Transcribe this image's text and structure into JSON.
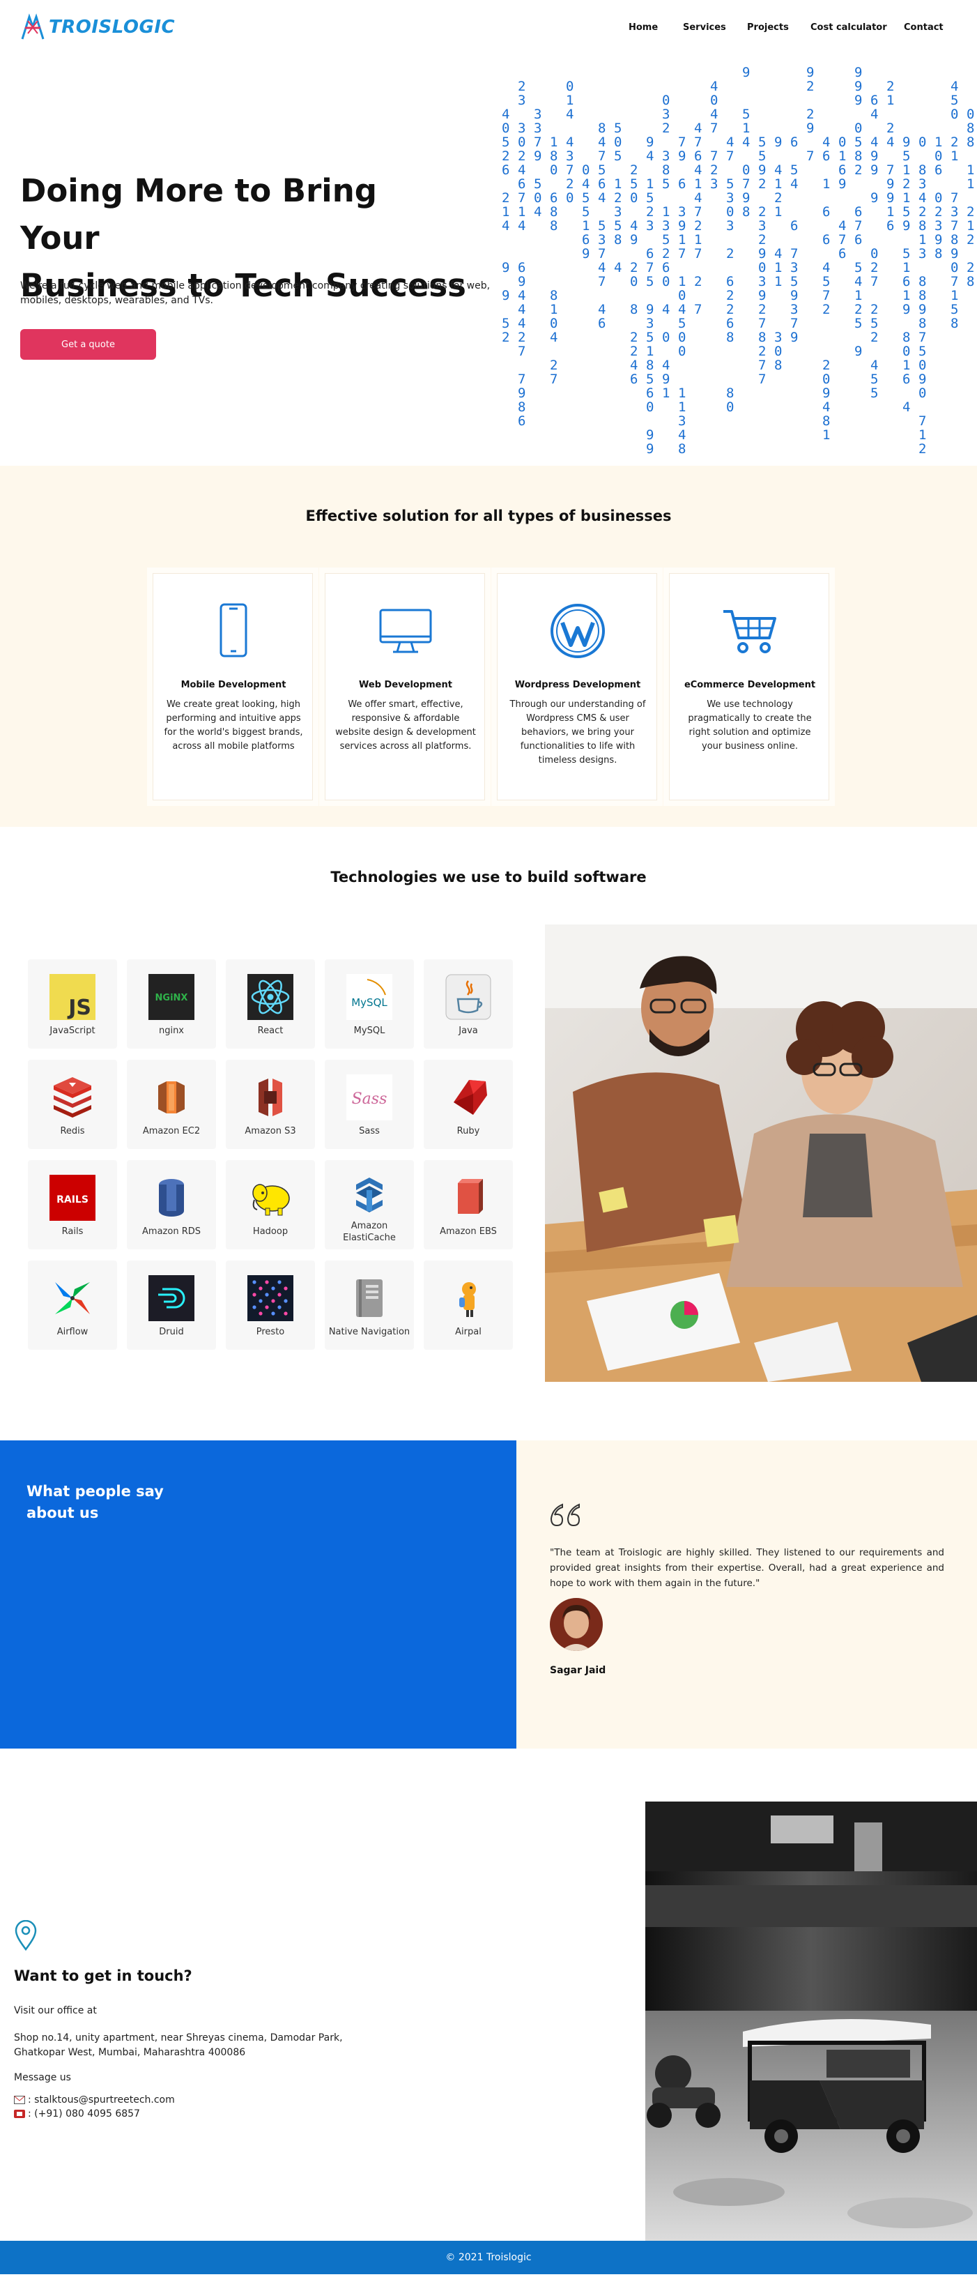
{
  "brand": {
    "name": "TROISLOGIC"
  },
  "nav": {
    "items": [
      "Home",
      "Services",
      "Projects",
      "Cost calculator",
      "Contact"
    ]
  },
  "hero": {
    "title_line1": "Doing More to Bring Your",
    "title_line2": "Business to Tech Success",
    "subtitle": "We're a full-cycle web and mobile application development company creating solutions for web, mobiles, desktops, wearables, and TVs.",
    "cta": "Get a quote"
  },
  "solutions": {
    "title": "Effective solution for all types of businesses",
    "cards": [
      {
        "icon": "mobile-icon",
        "title": "Mobile Development",
        "desc": "We create great looking, high performing and intuitive apps for the world's biggest brands, across all mobile platforms"
      },
      {
        "icon": "monitor-icon",
        "title": "Web Development",
        "desc": "We offer smart, effective, responsive & affordable website design & development services across all platforms."
      },
      {
        "icon": "wordpress-icon",
        "title": "Wordpress Development",
        "desc": "Through our understanding of Wordpress CMS & user behaviors, we bring your functionalities to life with timeless designs."
      },
      {
        "icon": "cart-icon",
        "title": "eCommerce Development",
        "desc": "We use technology pragmatically to create the right solution and optimize your business online."
      }
    ]
  },
  "tech": {
    "title": "Technologies we use to build software",
    "items": [
      {
        "name": "JavaScript",
        "icon": "javascript-logo"
      },
      {
        "name": "nginx",
        "icon": "nginx-logo"
      },
      {
        "name": "React",
        "icon": "react-logo"
      },
      {
        "name": "MySQL",
        "icon": "mysql-logo"
      },
      {
        "name": "Java",
        "icon": "java-logo"
      },
      {
        "name": "Redis",
        "icon": "redis-logo"
      },
      {
        "name": "Amazon EC2",
        "icon": "ec2-logo"
      },
      {
        "name": "Amazon S3",
        "icon": "s3-logo"
      },
      {
        "name": "Sass",
        "icon": "sass-logo"
      },
      {
        "name": "Ruby",
        "icon": "ruby-logo"
      },
      {
        "name": "Rails",
        "icon": "rails-logo"
      },
      {
        "name": "Amazon RDS",
        "icon": "rds-logo"
      },
      {
        "name": "Hadoop",
        "icon": "hadoop-logo"
      },
      {
        "name": "Amazon ElastiCache",
        "icon": "elasticache-logo"
      },
      {
        "name": "Amazon EBS",
        "icon": "ebs-logo"
      },
      {
        "name": "Airflow",
        "icon": "airflow-logo"
      },
      {
        "name": "Druid",
        "icon": "druid-logo"
      },
      {
        "name": "Presto",
        "icon": "presto-logo"
      },
      {
        "name": "Native Navigation",
        "icon": "native-navigation-logo"
      },
      {
        "name": "Airpal",
        "icon": "airpal-logo"
      }
    ],
    "logo_js_text": "JS",
    "logo_nginx_text": "NGiNX",
    "logo_mysql_text": "MySQL",
    "logo_sass_text": "Sass",
    "logo_rails_text": "RAILS"
  },
  "testimonial": {
    "heading_line1": "What people say",
    "heading_line2": "about us",
    "quote": "\"The team at Troislogic are highly skilled. They listened to our requirements and provided great insights from their expertise. Overall, had a great experience and hope to work with them again in the future.\"",
    "author": "Sagar Jaid"
  },
  "contact": {
    "title": "Want to get in touch?",
    "visit_label": "Visit our office at",
    "address_line1": "Shop no.14, unity apartment, near Shreyas cinema, Damodar Park,",
    "address_line2": "Ghatkopar West, Mumbai, Maharashtra 400086",
    "message_label": "Message us",
    "email": ": stalktous@spurtreetech.com",
    "phone": ": (+91) 080 4095 6857"
  },
  "footer": {
    "text": "© 2021 Troislogic"
  },
  "colors": {
    "primary_blue": "#0b68dc",
    "accent_pink": "#e0355e",
    "cream": "#fef8ec",
    "brand_blue": "#1a8fd8"
  }
}
